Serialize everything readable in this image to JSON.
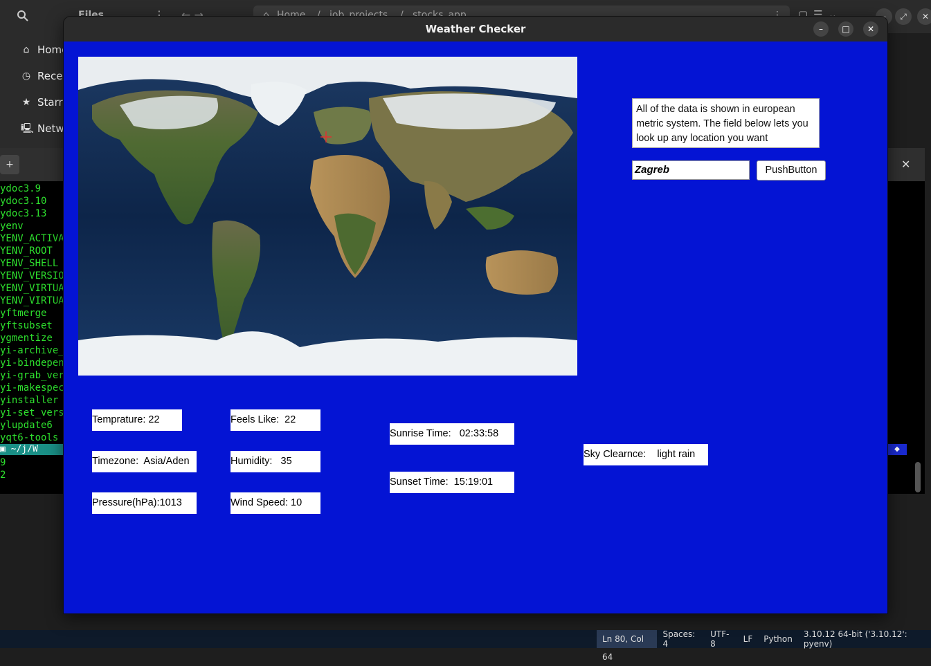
{
  "files": {
    "title": "Files",
    "path": [
      "Home",
      "/",
      "job_projects",
      "/",
      "stocks_app"
    ],
    "sidebar": [
      {
        "label": "Home",
        "icon": "home-icon"
      },
      {
        "label": "Recen",
        "icon": "clock-icon"
      },
      {
        "label": "Starre",
        "icon": "star-icon"
      },
      {
        "label": "Netwo",
        "icon": "network-icon"
      }
    ]
  },
  "terminal": {
    "lines": [
      "ydoc3.9",
      "ydoc3.10",
      "ydoc3.13",
      "yenv",
      "YENV_ACTIVA",
      "YENV_ROOT",
      "YENV_SHELL",
      "YENV_VERSIO",
      "YENV_VIRTUA",
      "YENV_VIRTUA",
      "yftmerge",
      "yftsubset",
      "ygmentize",
      "yi-archive_",
      "yi-bindepen",
      "yi-grab_ver",
      "yi-makespec",
      "yinstaller",
      "yi-set_vers",
      "ylupdate6",
      "yqt6-tools"
    ],
    "prompt": "~/j/W",
    "after_prompt": [
      "9",
      "2"
    ]
  },
  "status_bar": {
    "position": "Ln 80, Col 64",
    "spaces": "Spaces: 4",
    "encoding": "UTF-8",
    "eol": "LF",
    "language": "Python",
    "interpreter": "3.10.12 64-bit ('3.10.12': pyenv)"
  },
  "window": {
    "title": "Weather Checker",
    "info_text": "All of the data is shown in european metric system. The field below lets you look up any location you want",
    "city_value": "Zagreb",
    "button_label": "PushButton",
    "colors": {
      "background": "#0414d4",
      "label_bg": "#ffffff"
    }
  },
  "weather": {
    "temperature": "Temprature: 22",
    "feels_like": "Feels Like:  22",
    "timezone": "Timezone:  Asia/Aden",
    "humidity": "Humidity:   35",
    "pressure": "Pressure(hPa):1013",
    "wind_speed": "Wind Speed: 10",
    "sunrise": "Sunrise Time:   02:33:58",
    "sunset": "Sunset Time:  15:19:01",
    "sky": "Sky Clearnce:    light rain"
  }
}
